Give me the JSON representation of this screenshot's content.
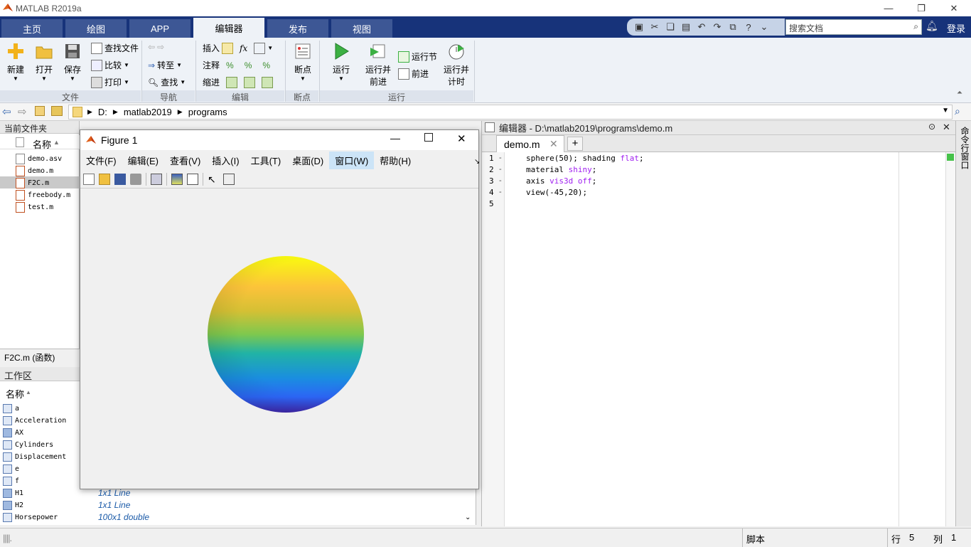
{
  "window": {
    "title": "MATLAB R2019a"
  },
  "tabs": [
    {
      "label": "主页"
    },
    {
      "label": "绘图"
    },
    {
      "label": "APP"
    },
    {
      "label": "编辑器"
    },
    {
      "label": "发布"
    },
    {
      "label": "视图"
    }
  ],
  "search": {
    "placeholder": "搜索文档"
  },
  "login_label": "登录",
  "ribbon": {
    "new": "新建",
    "open": "打开",
    "save": "保存",
    "find_file": "查找文件",
    "compare": "比较",
    "print": "打印",
    "goto": "转至",
    "find": "查找",
    "insert": "插入",
    "comment": "注释",
    "indent": "缩进",
    "breakpoint": "断点",
    "run": "运行",
    "run_advance_1": "运行并",
    "run_advance_2": "前进",
    "run_section": "运行节",
    "advance": "前进",
    "run_time_1": "运行并",
    "run_time_2": "计时",
    "groups": {
      "file": "文件",
      "nav": "导航",
      "edit": "编辑",
      "bp": "断点",
      "run": "运行"
    }
  },
  "address": {
    "parts": [
      "D:",
      "matlab2019",
      "programs"
    ]
  },
  "current_folder": {
    "title": "当前文件夹",
    "col_name": "名称",
    "files": [
      "demo.asv",
      "demo.m",
      "F2C.m",
      "freebody.m",
      "test.m"
    ],
    "selected_detail": "F2C.m  (函数)"
  },
  "workspace": {
    "title": "工作区",
    "col_name": "名称",
    "vars": [
      {
        "name": "a",
        "value": ""
      },
      {
        "name": "Acceleration",
        "value": ""
      },
      {
        "name": "AX",
        "value": ""
      },
      {
        "name": "Cylinders",
        "value": ""
      },
      {
        "name": "Displacement",
        "value": ""
      },
      {
        "name": "e",
        "value": ""
      },
      {
        "name": "f",
        "value": ""
      },
      {
        "name": "H1",
        "value": "1x1 Line"
      },
      {
        "name": "H2",
        "value": "1x1 Line"
      },
      {
        "name": "Horsepower",
        "value": "100x1 double"
      }
    ]
  },
  "editor": {
    "header": "编辑器 - D:\\matlab2019\\programs\\demo.m",
    "tab": "demo.m",
    "lines": [
      {
        "n": "1",
        "a": "sphere(50); shading ",
        "k": "flat",
        "b": ";"
      },
      {
        "n": "2",
        "a": "material ",
        "k": "shiny",
        "b": ";"
      },
      {
        "n": "3",
        "a": "axis ",
        "k": "vis3d off",
        "b": ";"
      },
      {
        "n": "4",
        "a": "view(-45,20);",
        "k": "",
        "b": ""
      },
      {
        "n": "5",
        "a": "",
        "k": "",
        "b": ""
      }
    ]
  },
  "command_window_label": "命令行窗口",
  "status": {
    "mode": "脚本",
    "row_label": "行",
    "row": "5",
    "col_label": "列",
    "col": "1"
  },
  "figure": {
    "title": "Figure 1",
    "menus": [
      "文件(F)",
      "编辑(E)",
      "查看(V)",
      "插入(I)",
      "工具(T)",
      "桌面(D)",
      "窗口(W)",
      "帮助(H)"
    ]
  },
  "colors": {
    "tab_strip": "#17337a",
    "tab": "#3d5795",
    "ribbon": "#eef2f7",
    "keyword": "#a020f0",
    "sphere_top": "#f9fb0e",
    "sphere_mid": "#21b3a5",
    "sphere_bottom": "#3e26a8"
  }
}
